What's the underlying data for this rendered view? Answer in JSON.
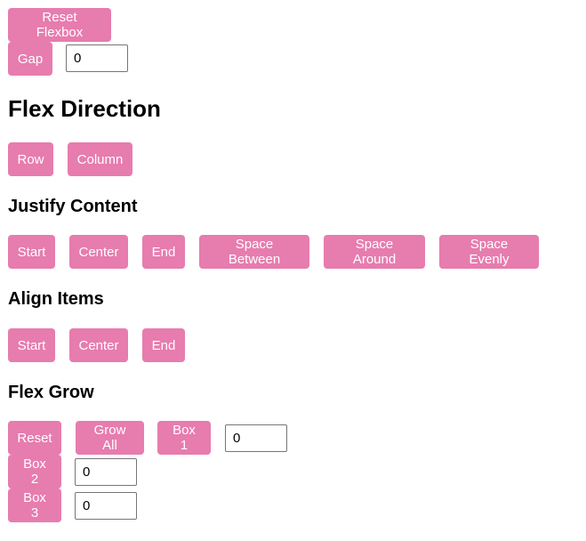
{
  "controls": {
    "reset_flexbox": "Reset Flexbox",
    "gap_label": "Gap",
    "gap_value": "0"
  },
  "flex_direction": {
    "title": "Flex Direction",
    "buttons": [
      "Row",
      "Column"
    ]
  },
  "justify_content": {
    "title": "Justify Content",
    "buttons": [
      "Start",
      "Center",
      "End",
      "Space Between",
      "Space Around",
      "Space Evenly"
    ]
  },
  "align_items": {
    "title": "Align Items",
    "buttons": [
      "Start",
      "Center",
      "End"
    ]
  },
  "flex_grow": {
    "title": "Flex Grow",
    "reset": "Reset",
    "grow_all": "Grow All",
    "box1_label": "Box 1",
    "box1_value": "0",
    "box2_label": "Box 2",
    "box2_value": "0",
    "box3_label": "Box 3",
    "box3_value": "0"
  },
  "colors": {
    "button_bg": "#e77cae",
    "button_text": "#ffffff"
  }
}
